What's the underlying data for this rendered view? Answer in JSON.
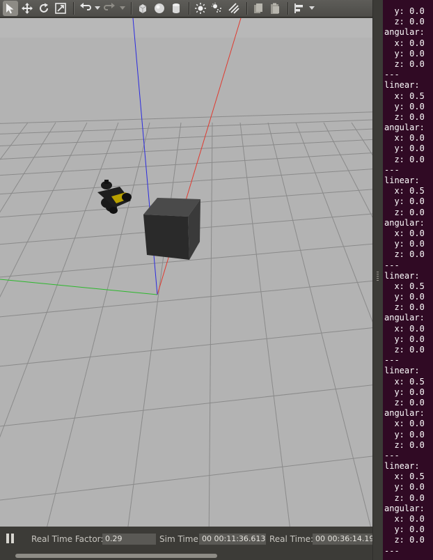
{
  "toolbar": {
    "tools": [
      {
        "name": "select-mode-icon",
        "active": true
      },
      {
        "name": "translate-mode-icon",
        "active": false
      },
      {
        "name": "rotate-mode-icon",
        "active": false
      },
      {
        "name": "scale-mode-icon",
        "active": false
      },
      {
        "name": "undo-icon",
        "active": false
      },
      {
        "name": "redo-icon",
        "active": false
      },
      {
        "name": "box-shape-icon",
        "active": false
      },
      {
        "name": "sphere-shape-icon",
        "active": false
      },
      {
        "name": "cylinder-shape-icon",
        "active": false
      },
      {
        "name": "point-light-icon",
        "active": false
      },
      {
        "name": "spot-light-icon",
        "active": false
      },
      {
        "name": "directional-light-icon",
        "active": false
      },
      {
        "name": "copy-icon",
        "active": false
      },
      {
        "name": "paste-icon",
        "active": false
      },
      {
        "name": "align-icon",
        "active": false
      }
    ]
  },
  "viewport": {
    "colors": {
      "ground": "#b3b3b3",
      "sky": "#b8b8b8",
      "grid": "#8a8a8a",
      "axis_x": "#e03a2f",
      "axis_y": "#2cb82c",
      "axis_z": "#2a2ae0",
      "box_front": "#2a2a2a",
      "box_side": "#3a3a3a",
      "box_top": "#4a4a4a",
      "robot": "#1a1a1a",
      "robot_accent": "#b8a000"
    }
  },
  "statusbar": {
    "real_time_factor_label": "Real Time Factor:",
    "real_time_factor_value": "0.29",
    "sim_time_label": "Sim Time:",
    "sim_time_value": "00 00:11:36.613",
    "real_time_label": "Real Time:",
    "real_time_value": "00 00:36:14.19"
  },
  "terminal": {
    "lines": [
      "  y: 0.0",
      "  z: 0.0",
      "angular:",
      "  x: 0.0",
      "  y: 0.0",
      "  z: 0.0",
      "---",
      "linear:",
      "  x: 0.5",
      "  y: 0.0",
      "  z: 0.0",
      "angular:",
      "  x: 0.0",
      "  y: 0.0",
      "  z: 0.0",
      "---",
      "linear:",
      "  x: 0.5",
      "  y: 0.0",
      "  z: 0.0",
      "angular:",
      "  x: 0.0",
      "  y: 0.0",
      "  z: 0.0",
      "---",
      "linear:",
      "  x: 0.5",
      "  y: 0.0",
      "  z: 0.0",
      "angular:",
      "  x: 0.0",
      "  y: 0.0",
      "  z: 0.0",
      "---",
      "linear:",
      "  x: 0.5",
      "  y: 0.0",
      "  z: 0.0",
      "angular:",
      "  x: 0.0",
      "  y: 0.0",
      "  z: 0.0",
      "---",
      "linear:",
      "  x: 0.5",
      "  y: 0.0",
      "  z: 0.0",
      "angular:",
      "  x: 0.0",
      "  y: 0.0",
      "  z: 0.0",
      "---"
    ]
  }
}
